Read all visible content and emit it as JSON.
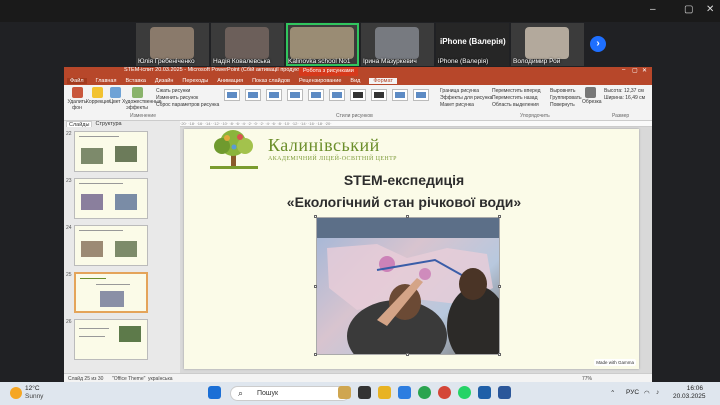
{
  "zoom": {
    "participants": [
      {
        "name": "Юлія Гребеніченко",
        "kind": "video",
        "color": "#8a7a6b"
      },
      {
        "name": "Надія Ковалевська",
        "kind": "video",
        "color": "#6c5f5a"
      },
      {
        "name": "Kalinovka school No1",
        "kind": "video",
        "color": "#9a8c74",
        "active": true
      },
      {
        "name": "Ірина Мазуркевич",
        "kind": "video",
        "color": "#777a80"
      },
      {
        "name": "iPhone (Валерія)",
        "kind": "name"
      },
      {
        "name": "Володимир Рой",
        "kind": "video",
        "color": "#b3a99c"
      }
    ],
    "big_label": "iPhone (Валерія)",
    "next_icon": "chevron-right-icon",
    "window_controls": [
      "–",
      "▢",
      "✕"
    ]
  },
  "ppt": {
    "title": "STEM-іспит 20.03.2025 - Microsoft PowerPoint (Сбій активації продукту)",
    "contextual_tab": "Робота з рисунками",
    "window_controls": [
      "–",
      "▢",
      "✕"
    ],
    "tabs": [
      "Файл",
      "Главная",
      "Вставка",
      "Дизайн",
      "Переходы",
      "Анимация",
      "Показ слайдов",
      "Рецензирование",
      "Вид",
      "Формат"
    ],
    "active_tab": "Формат",
    "ribbon": {
      "remove_bg": "Удалить фон",
      "corrections": "Коррекция",
      "color": "Цвет",
      "artistic": "Художественные эффекты",
      "adjust_list": [
        "Сжать рисунки",
        "Изменить рисунок",
        "Сброс параметров рисунка"
      ],
      "group_adjust": "Изменение",
      "group_styles": "Стили рисунков",
      "style_list": [
        "Граница рисунка",
        "Эффекты для рисунка",
        "Макет рисунка"
      ],
      "arrange_list": [
        "Переместить вперед",
        "Переместить назад",
        "Область выделения"
      ],
      "arrange_list2": [
        "Выровнять",
        "Группировать",
        "Повернуть"
      ],
      "group_arrange": "Упорядочить",
      "crop": "Обрезка",
      "height_label": "Высота:",
      "height_value": "12,37 см",
      "width_label": "Ширина:",
      "width_value": "16,49 см",
      "group_size": "Размер"
    },
    "pane_tabs": [
      "Слайды",
      "Структура"
    ],
    "slide_numbers": [
      "22",
      "23",
      "24",
      "25",
      "26"
    ],
    "selected_slide": "25",
    "ruler_text": "·20· ·18· ·16· ·14· ·12· ·10· ·8· ·6· ·4· ·2· ·0· ·2· ·4· ·6· ·8· ·10· ·12· ·14· ·16· ·18· ·20·",
    "slide": {
      "brand_name": "Калинівський",
      "brand_sub": "АКАДЕМІЧНИЙ ЛІЦЕЙ-ОСВІТНІЙ ЦЕНТР",
      "title_line1": "STEM-експедиція",
      "title_line2": "«Екологічний стан річкової води»",
      "gamma_badge": "Made with Gamma"
    },
    "status": {
      "slide_of": "Слайд 25 из 30",
      "theme": "\"Office Theme\"",
      "language": "українська",
      "zoom": "77%"
    }
  },
  "taskbar": {
    "temperature": "12°C",
    "weather": "Sunny",
    "search_placeholder": "Пошук",
    "language": "РУС",
    "time": "16:06",
    "date": "20.03.2025"
  }
}
